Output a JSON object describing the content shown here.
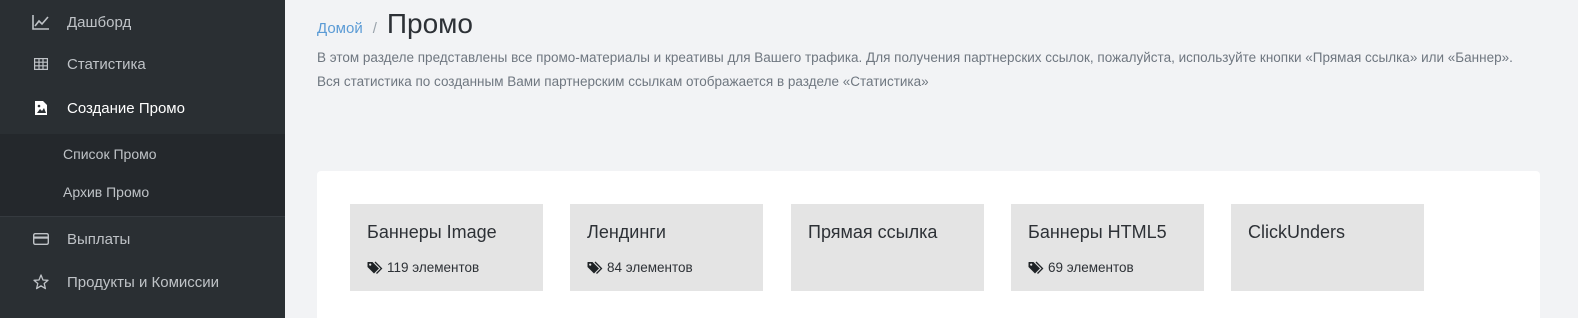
{
  "sidebar": {
    "items": [
      {
        "label": "Дашборд",
        "icon": "chart-line-icon"
      },
      {
        "label": "Статистика",
        "icon": "table-icon"
      },
      {
        "label": "Создание Промо",
        "icon": "image-file-icon",
        "active": true
      },
      {
        "label": "Выплаты",
        "icon": "credit-card-icon"
      },
      {
        "label": "Продукты и Комиссии",
        "icon": "star-icon"
      }
    ],
    "subitems": [
      {
        "label": "Список Промо"
      },
      {
        "label": "Архив Промо"
      }
    ]
  },
  "breadcrumb": {
    "home": "Домой",
    "separator": "/",
    "current": "Промо"
  },
  "description": "В этом разделе представлены все промо-материалы и креативы для Вашего трафика. Для получения партнерских ссылок, пожалуйста, используйте кнопки «Прямая ссылка» или «Баннер». Вся статистика по созданным Вами партнерским ссылкам отображается в разделе «Статистика»",
  "cards": [
    {
      "title": "Баннеры Image",
      "count": "119 элементов"
    },
    {
      "title": "Лендинги",
      "count": "84 элементов"
    },
    {
      "title": "Прямая ссылка",
      "count": ""
    },
    {
      "title": "Баннеры HTML5",
      "count": "69 элементов"
    },
    {
      "title": "ClickUnders",
      "count": ""
    }
  ],
  "colors": {
    "sidebar_bg": "#2a2f33",
    "link": "#5b9bd5",
    "card_bg": "#e4e4e4"
  }
}
